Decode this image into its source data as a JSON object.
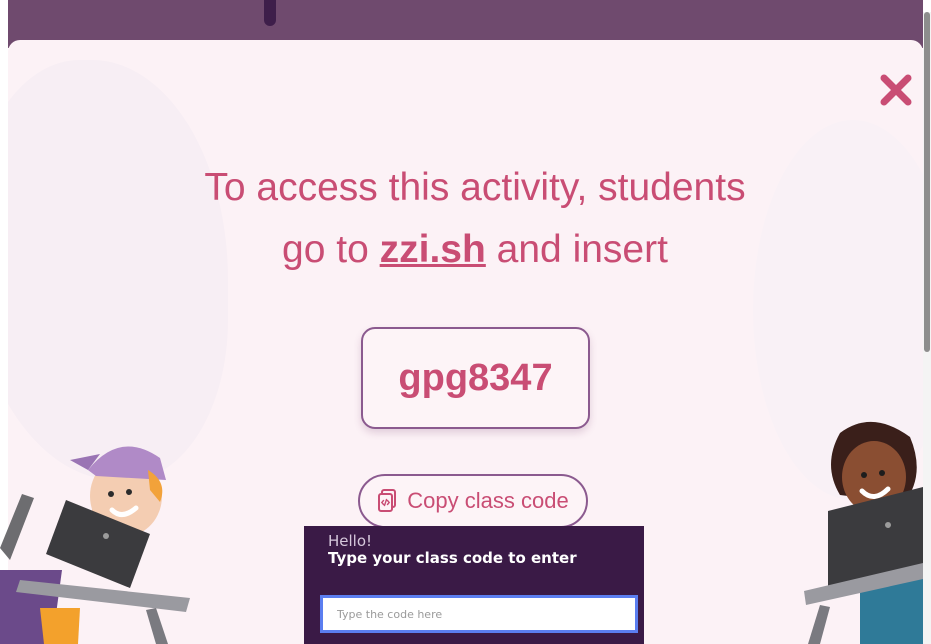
{
  "modal": {
    "headline_line1": "To access this activity, students",
    "headline_prefix": "go to",
    "headline_link": "zzi.sh",
    "headline_suffix": "and insert",
    "class_code": "gpg8347",
    "copy_button_label": "Copy class code",
    "close_icon": "close-icon",
    "copy_icon": "copy-code-icon"
  },
  "join_panel": {
    "greeting": "Hello!",
    "prompt": "Type your class code to enter",
    "input_placeholder": "Type the code here",
    "input_value": ""
  },
  "colors": {
    "accent_pink": "#c94d74",
    "accent_purple": "#8b5a8f",
    "top_band": "#6f4a6e",
    "modal_bg": "#fcf2f6",
    "panel_bg": "#3a1a46",
    "input_border": "#5b7ef0"
  }
}
